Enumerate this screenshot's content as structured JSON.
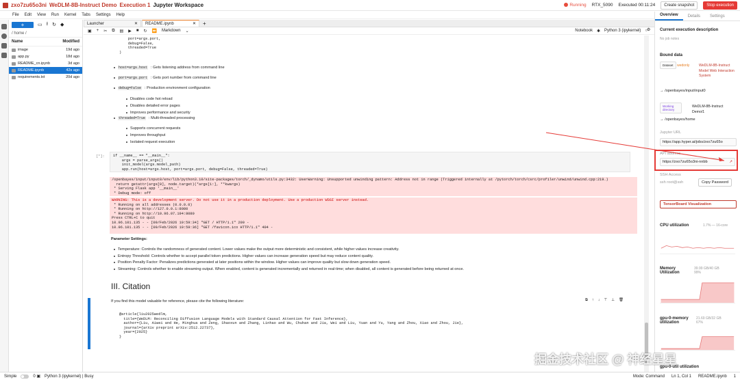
{
  "topbar": {
    "user": "zxo7zu65o3ni",
    "project": "WeDLM-8B-Instruct Demo",
    "execution": "Execution 1",
    "workspace": "Jupyter Workspace",
    "status": "Running",
    "gpu": "RTX_5090",
    "executed": "Executed 00:11:24",
    "create_snapshot": "Create snapshot",
    "stop_execution": "Stop execution"
  },
  "menu": [
    "File",
    "Edit",
    "View",
    "Run",
    "Kernel",
    "Tabs",
    "Settings",
    "Help"
  ],
  "files": {
    "breadcrumb": "/ home /",
    "col_name": "Name",
    "col_modified": "Modified",
    "items": [
      {
        "name": "image",
        "modified": "19d ago"
      },
      {
        "name": "app.py",
        "modified": "18d ago"
      },
      {
        "name": "README_cn.ipynb",
        "modified": "3d ago"
      },
      {
        "name": "README.ipynb",
        "modified": "42s ago"
      },
      {
        "name": "requirements.txt",
        "modified": "20d ago"
      }
    ]
  },
  "tabs": [
    {
      "label": "Launcher"
    },
    {
      "label": "README.ipynb"
    }
  ],
  "nbtool": {
    "celltype": "Markdown",
    "notebook": "Notebook",
    "kernel": "Python 3 (ipykernel)"
  },
  "notebook": {
    "code_top": "    port=args.port,\n    debug=False,\n    threaded=True\n)",
    "bullets1": [
      {
        "code": "host=args.host",
        "text": ": Gets listening address from command line"
      },
      {
        "code": "port=args.port",
        "text": ": Gets port number from command line"
      },
      {
        "code": "debug=False",
        "text": ": Production environment configuration"
      }
    ],
    "sub1": [
      "Disables code hot reload",
      "Disables detailed error pages",
      "Improves performance and security"
    ],
    "bullets2": [
      {
        "code": "threaded=True",
        "text": ": Multi-threaded processing"
      }
    ],
    "sub2": [
      "Supports concurrent requests",
      "Improves throughput",
      "Isolated request execution"
    ],
    "prompt": "[*]:",
    "code_cell": "if __name__ == \"__main__\":\n    args = parse_args()\n    init_model(args.model_path)\n    app.run(host=args.host, port=args.port, debug=False, threaded=True)",
    "warn_out": "/openbayes/input/input0/env/lib/python3.10/site-packages/torch/_dynamo/utils.py:3432: UserWarning: Unsupported unwinding pattern: Address not in range (Triggered internally at /pytorch/torch/csrc/profiler/unwind/unwind.cpp:219.)\n  return getattr(args[0], node.target)(*args[1:], **kwargs)\n * Serving Flask app '__main__'\n * Debug mode: off",
    "run_out_warn": "WARNING: This is a development server. Do not use it in a production deployment. Use a production WSGI server instead.",
    "run_out": " * Running on all addresses (0.0.0.0)\n * Running on http://127.0.0.1:8080\n * Running on http://10.96.07.194:8080\nPress CTRL+C to quit\n10.96.101.135 - - [09/Feb/2026 10:59:34] \"GET / HTTP/1.1\" 200 -\n10.96.101.135 - - [09/Feb/2026 10:59:36] \"GET /favicon.ico HTTP/1.1\" 404 -",
    "params_title": "Parameter Settings:",
    "params": [
      "Temperature: Controls the randomness of generated content. Lower values make the output more deterministic and consistent, while higher values increase creativity.",
      "Entropy Threshold: Controls whether to accept parallel token predictions. Higher values can increase generation speed but may reduce content quality.",
      "Position Penalty Factor: Penalizes predictions generated at later positions within the window. Higher values can improve quality but slow down generation speed.",
      "Streaming: Controls whether to enable streaming output. When enabled, content is generated incrementally and returned in real-time; when disabled, all content is generated before being returned at once."
    ],
    "heading": "III. Citation",
    "cite_intro": "If you find this model valuable for reference, please cite the following literature:",
    "bibtex": "@article{liu2025wedlm,\n  title={WeDLM: Reconciling Diffusion Language Models with Standard Causal Attention for Fast Inference},\n  author={Liu, Aiwei and He, Minghua and Zeng, Shaoxun and Zhang, Linhao and Wu, Chuhan and Jia, Wei and Liu, Yuan and Yu, Yang and Zhou, Xiao and Zhou, Jie},\n  journal={arXiv preprint arXiv:2512.22737},\n  year={2025}\n}"
  },
  "sidebar": {
    "tabs": [
      "Overview",
      "Details",
      "Settings"
    ],
    "exec_desc_title": "Current execution description",
    "exec_desc": "No job notes",
    "bound_title": "Bound data",
    "dataset_tag": "Dataset",
    "dataset_org": "wedonly",
    "dataset_name": "WeDLM-8B-Instruct Model Web Interaction System",
    "dataset_path": "/openbayes/input/input0",
    "workdir_tag": "Working directory",
    "workdir_name": "WeDLM-8B-Instruct Demo/1",
    "workdir_path": "/openbayes/home",
    "jupyter_title": "Jupyter URL",
    "jupyter_url": "https://app.hyper.ai/jobs/zxo7zu65o",
    "api_title": "API address",
    "api_url": "https://zxo7zu65o3ni-nnbb",
    "ssh_title": "SSH Access",
    "ssh_cmd": "ssh root@ssh",
    "copy_pw": "Copy Password",
    "tensorboard": "TensorBoard Visualization",
    "cpu_title": "CPU utilization",
    "cpu_val": "1.7% — 16-core",
    "mem_title": "Memory Utilization",
    "mem_val": "39.99 GB/40 GB",
    "mem_pct": "99%",
    "gpumem_title": "gpu-0-memory utilization",
    "gpumem_val": "21.69 GB/32 GB",
    "gpumem_pct": "67%",
    "gpu_title": "gpu-0-util utilization"
  },
  "status": {
    "mode_label": "Simple",
    "kernel": "Python 3 (ipykernel) | Busy",
    "cmd": "Mode: Command",
    "pos": "Ln 1, Col 1",
    "file": "README.ipynb",
    "bell": "1"
  },
  "watermark": "掘金技术社区 @ 神经星星"
}
